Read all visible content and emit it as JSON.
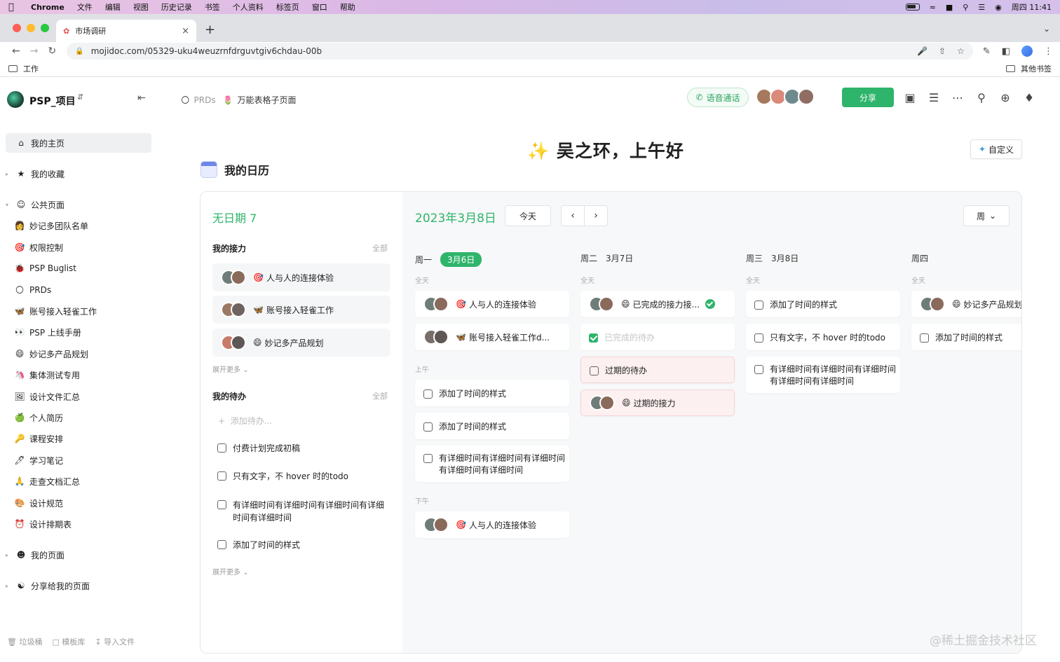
{
  "mac_menubar": {
    "items": [
      "Chrome",
      "文件",
      "编辑",
      "视图",
      "历史记录",
      "书签",
      "个人资料",
      "标签页",
      "窗口",
      "帮助"
    ],
    "clock": "周四 11:41"
  },
  "browser": {
    "tab_title": "市场调研",
    "url": "mojidoc.com/05329-uku4weuzrnfdrguvtgiv6chdau-00b",
    "bookmark_folder": "工作",
    "other_bookmarks": "其他书签"
  },
  "workspace": {
    "name": "PSP_项目"
  },
  "breadcrumb": {
    "parent": "PRDs",
    "current": "万能表格子页面"
  },
  "header": {
    "voice_call": "语音通话",
    "share": "分享"
  },
  "sidebar": {
    "home": "我的主页",
    "favorites": "我的收藏",
    "public_pages": "公共页面",
    "public_items": [
      {
        "icon": "👩",
        "label": "妙记多团队名单"
      },
      {
        "icon": "🎯",
        "label": "权限控制"
      },
      {
        "icon": "🐞",
        "label": "PSP Buglist"
      },
      {
        "icon": "🌕",
        "label": "PRDs"
      },
      {
        "icon": "🦋",
        "label": "账号接入轻雀工作"
      },
      {
        "icon": "👀",
        "label": "PSP 上线手册"
      },
      {
        "icon": "😄",
        "label": "妙记多产品规划"
      },
      {
        "icon": "🦄",
        "label": "集体测试专用"
      },
      {
        "icon": "🖼",
        "label": "设计文件汇总"
      },
      {
        "icon": "🍏",
        "label": "个人简历"
      },
      {
        "icon": "🔑",
        "label": "课程安排"
      },
      {
        "icon": "🖊",
        "label": "学习笔记"
      },
      {
        "icon": "🙏",
        "label": "走查文档汇总"
      },
      {
        "icon": "🎨",
        "label": "设计规范"
      },
      {
        "icon": "⏰",
        "label": "设计排期表"
      }
    ],
    "my_pages": "我的页面",
    "shared_with_me": "分享给我的页面",
    "bottom": {
      "trash": "垃圾桶",
      "templates": "模板库",
      "import": "导入文件"
    }
  },
  "main": {
    "greeting": "吴之环，上午好",
    "customize": "自定义",
    "calendar_title": "我的日历"
  },
  "left_panel": {
    "no_date": "无日期 7",
    "relay_title": "我的接力",
    "all": "全部",
    "relay_items": [
      {
        "emoji": "🎯",
        "label": "人与人的连接体验"
      },
      {
        "emoji": "🦋",
        "label": "账号接入轻雀工作"
      },
      {
        "emoji": "😄",
        "label": "妙记多产品规划"
      }
    ],
    "expand_more": "展开更多",
    "todo_title": "我的待办",
    "add_todo": "添加待办...",
    "todos": [
      "付费计划完成初稿",
      "只有文字，不 hover 时的todo",
      "有详细时间有详细时间有详细时间有详细时间有详细时间",
      "添加了时间的样式"
    ]
  },
  "calendar": {
    "date_title": "2023年3月8日",
    "today": "今天",
    "view": "周",
    "labels": {
      "all_day": "全天",
      "morning": "上午",
      "afternoon": "下午"
    },
    "days": [
      {
        "weekday": "周一",
        "date": "3月6日"
      },
      {
        "weekday": "周二",
        "date": "3月7日"
      },
      {
        "weekday": "周三",
        "date": "3月8日"
      },
      {
        "weekday": "周四",
        "date": ""
      }
    ],
    "mon": {
      "allday": [
        {
          "emoji": "🎯",
          "label": "人与人的连接体验"
        },
        {
          "emoji": "🦋",
          "label": "账号接入轻雀工作d..."
        }
      ],
      "morning": [
        "添加了时间的样式",
        "添加了时间的样式",
        "有详细时间有详细时间有详细时间有详细时间有详细时间"
      ],
      "afternoon": [
        {
          "emoji": "🎯",
          "label": "人与人的连接体验"
        }
      ]
    },
    "tue": {
      "completed_relay": "已完成的接力接...",
      "completed_todo": "已完成的待办",
      "overdue_todo": "过期的待办",
      "overdue_relay": "过期的接力"
    },
    "wed": [
      "添加了时间的样式",
      "只有文字，不 hover 时的todo",
      "有详细时间有详细时间有详细时间有详细时间有详细时间"
    ],
    "thu": {
      "relay": "妙记多产品规划",
      "todo": "添加了时间的样式"
    }
  },
  "watermark": "@稀土掘金技术社区",
  "colors": {
    "accent": "#2fb46b",
    "overdue_bg": "#fdf0f0"
  }
}
